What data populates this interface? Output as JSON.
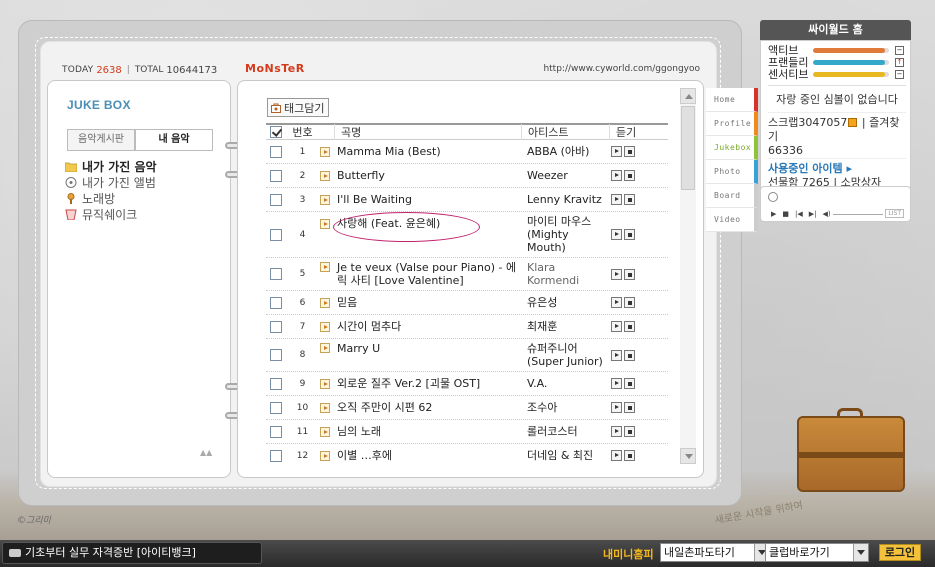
{
  "header": {
    "today_label": "TODAY",
    "today_count": "2638",
    "total_label": "TOTAL",
    "total_count": "10644173",
    "title": "MoNsTeR",
    "url": "http://www.cyworld.com/ggongyoo"
  },
  "left": {
    "title": "JUKE BOX",
    "tabs": [
      "음악게시판",
      "내 음악"
    ],
    "menu": [
      {
        "label": "내가 가진 음악",
        "icon": "folder-icon",
        "active": true
      },
      {
        "label": "내가 가진 앨범",
        "icon": "album-icon",
        "active": false
      },
      {
        "label": "노래방",
        "icon": "microphone-icon",
        "active": false
      },
      {
        "label": "뮤직쉐이크",
        "icon": "cup-icon",
        "active": false
      }
    ],
    "scroll_mark": "▲▲"
  },
  "jukebox": {
    "tag_button": "태그담기",
    "columns": {
      "num": "번호",
      "title": "곡명",
      "artist": "아티스트",
      "listen": "듣기"
    },
    "rows": [
      {
        "num": "1",
        "title": "Mamma Mia (Best)",
        "artist": "ABBA (아바)"
      },
      {
        "num": "2",
        "title": "Butterfly",
        "artist": "Weezer"
      },
      {
        "num": "3",
        "title": "I'll Be Waiting",
        "artist": "Lenny Kravitz"
      },
      {
        "num": "4",
        "title": "사랑해 (Feat. 윤은혜)",
        "artist": "마이티 마우스 (Mighty Mouth)"
      },
      {
        "num": "5",
        "title": "Je te veux (Valse pour Piano) - 에릭 사티 [Love Valentine]",
        "artist": "Klara Kormendi"
      },
      {
        "num": "6",
        "title": "믿음",
        "artist": "유은성"
      },
      {
        "num": "7",
        "title": "시간이 멈추다",
        "artist": "최재훈"
      },
      {
        "num": "8",
        "title": "Marry U",
        "artist": "슈퍼주니어 (Super Junior)"
      },
      {
        "num": "9",
        "title": "외로운 질주 Ver.2 [괴물 OST]",
        "artist": "V.A."
      },
      {
        "num": "10",
        "title": "오직 주만이 시편 62",
        "artist": "조수아"
      },
      {
        "num": "11",
        "title": "님의 노래",
        "artist": "롤러코스터"
      },
      {
        "num": "12",
        "title": "이별 …후에",
        "artist": "더네임 & 최진"
      }
    ]
  },
  "side_tabs": [
    {
      "label": "Home",
      "color": "#d9322a"
    },
    {
      "label": "Profile",
      "color": "#f08a1c"
    },
    {
      "label": "Jukebox",
      "color": "#8cc43c"
    },
    {
      "label": "Photo",
      "color": "#3aa0d8"
    },
    {
      "label": "Board",
      "color": "#cccccc"
    },
    {
      "label": "Video",
      "color": "#cccccc"
    }
  ],
  "cyworld": {
    "head": "싸이월드 홈",
    "meters": [
      {
        "label": "액티브",
        "color": "#e07a3a",
        "btn": "−",
        "level": 0.95
      },
      {
        "label": "프랜들리",
        "color": "#34a8c8",
        "btn": "↑",
        "level": 0.95
      },
      {
        "label": "센서티브",
        "color": "#e8b820",
        "btn": "−",
        "level": 0.95
      }
    ],
    "message": "자랑 중인 심볼이 없습니다",
    "scrap_label": "스크랩",
    "scrap_count": "3047057",
    "fav_label": "즐겨찾기",
    "fav_count": "66336",
    "item_label": "사용중인 아이템 ▸",
    "gift_label": "선물함",
    "gift_count": "7265",
    "wish_label": "소망상자"
  },
  "player": {
    "list_label": "LIST"
  },
  "decor": {
    "signature": "©그리미",
    "handwriting": "새로운 시작을 위하여"
  },
  "bottombar": {
    "ad": "기초부터 실무 자격증반 [아이티뱅크]",
    "mini": "내미니홈피",
    "select1": "내일촌파도타기",
    "select2": "클럽바로가기",
    "login": "로그인"
  }
}
